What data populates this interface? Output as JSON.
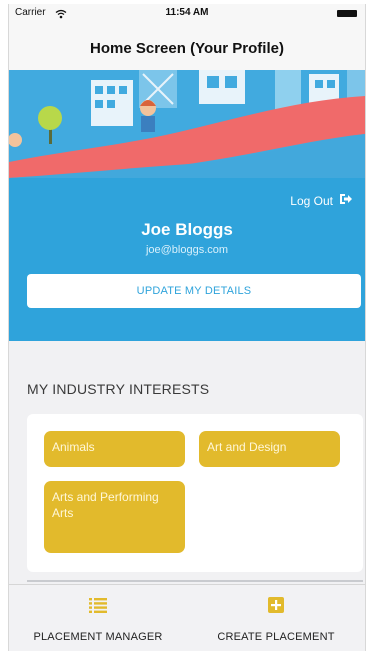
{
  "status_bar": {
    "carrier": "Carrier",
    "time": "11:54 AM"
  },
  "nav": {
    "title": "Home Screen (Your Profile)"
  },
  "profile": {
    "logout_label": "Log Out",
    "name": "Joe Bloggs",
    "email": "joe@bloggs.com",
    "update_button": "UPDATE MY DETAILS"
  },
  "interests": {
    "title": "MY INDUSTRY INTERESTS",
    "items": [
      "Animals",
      "Art and Design",
      "Arts and Performing Arts"
    ]
  },
  "tab_bar": {
    "items": [
      {
        "label": "PLACEMENT MANAGER",
        "icon": "list-icon"
      },
      {
        "label": "CREATE PLACEMENT",
        "icon": "plus-square-icon"
      }
    ]
  },
  "colors": {
    "brand_blue": "#2fa3db",
    "chip_yellow": "#e2ba2c",
    "banner_wave": "#f06a6a"
  }
}
